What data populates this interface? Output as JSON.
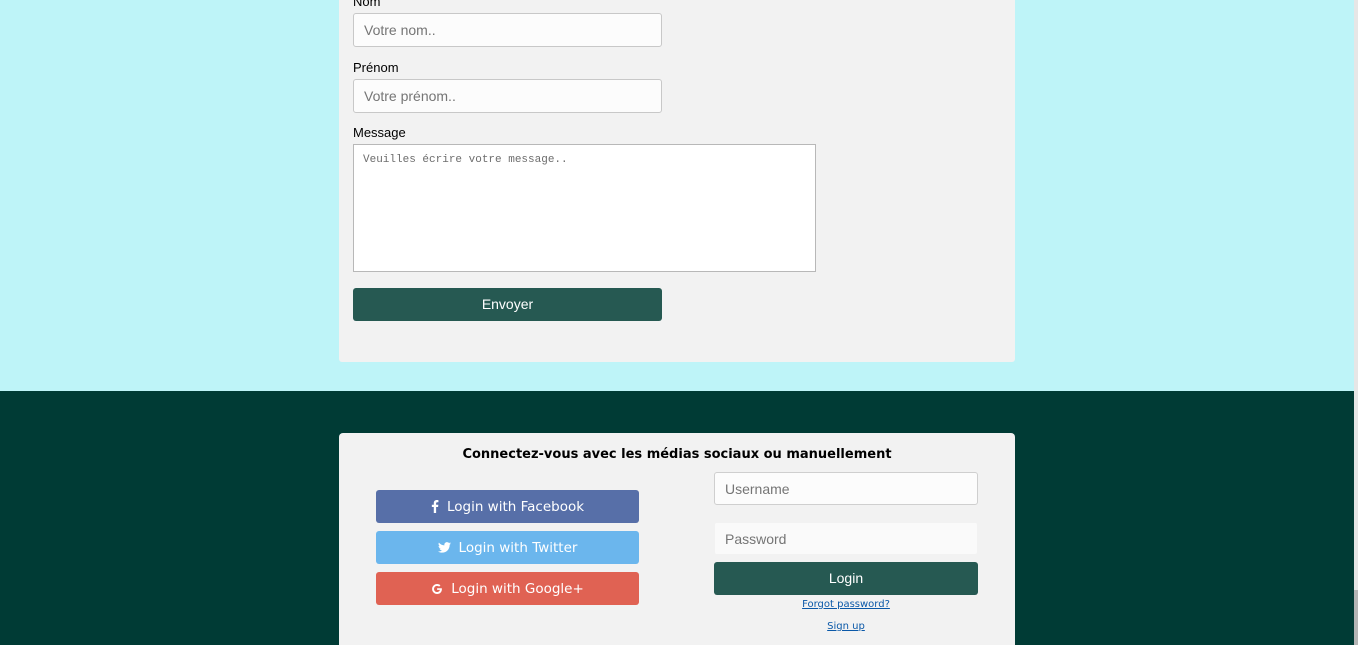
{
  "contact": {
    "nom_label": "Nom",
    "nom_placeholder": "Votre nom..",
    "prenom_label": "Prénom",
    "prenom_placeholder": "Votre prénom..",
    "message_label": "Message",
    "message_placeholder": "Veuilles écrire votre message..",
    "send_label": "Envoyer"
  },
  "login": {
    "title": "Connectez-vous avec les médias sociaux ou manuellement",
    "facebook_label": "Login with Facebook",
    "twitter_label": "Login with Twitter",
    "google_label": "Login with Google+",
    "username_placeholder": "Username",
    "password_placeholder": "Password",
    "login_label": "Login",
    "forgot_label": "Forgot password?",
    "signup_label": "Sign up"
  },
  "colors": {
    "top_background": "#bef4f8",
    "footer_background": "#003b35",
    "button_primary": "#265952",
    "facebook": "#576fa8",
    "twitter": "#6bb6ed",
    "google": "#e06253"
  },
  "icons": {
    "facebook": "facebook-icon",
    "twitter": "twitter-icon",
    "google": "google-icon"
  }
}
